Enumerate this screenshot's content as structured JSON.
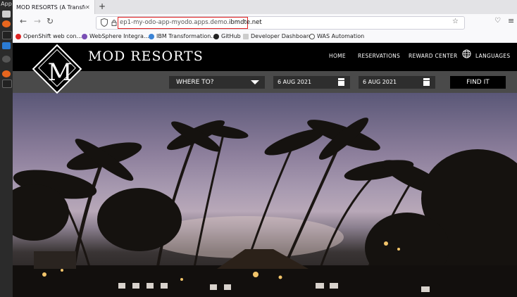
{
  "dock": {
    "apps_label": "App"
  },
  "browser": {
    "tab_title": "MOD RESORTS (A Transform",
    "new_tab": "+",
    "url_prefix": "ep1-my-odo-app-myodo.apps.demo.",
    "url_domain": "ibmdte.net",
    "bookmarks": [
      {
        "label": "OpenShift web con...",
        "color": "#e02424"
      },
      {
        "label": "WebSphere Integra...",
        "color": "#7a4fb5"
      },
      {
        "label": "IBM Transformation...",
        "color": "#3a83d6"
      },
      {
        "label": "GitHub",
        "color": "#222222"
      },
      {
        "label": "Developer Dashboard",
        "color": "#cccccc"
      },
      {
        "label": "WAS Automation",
        "color": "#555555"
      }
    ]
  },
  "site": {
    "brand": "MOD RESORTS",
    "logo_letter": "M",
    "nav": {
      "home": "HOME",
      "reservations": "RESERVATIONS",
      "reward_center": "REWARD CENTER",
      "languages": "LANGUAGES"
    },
    "search": {
      "where": "WHERE TO?",
      "check_in": "6 AUG 2021",
      "check_out": "6 AUG 2021",
      "find": "FIND IT"
    }
  }
}
